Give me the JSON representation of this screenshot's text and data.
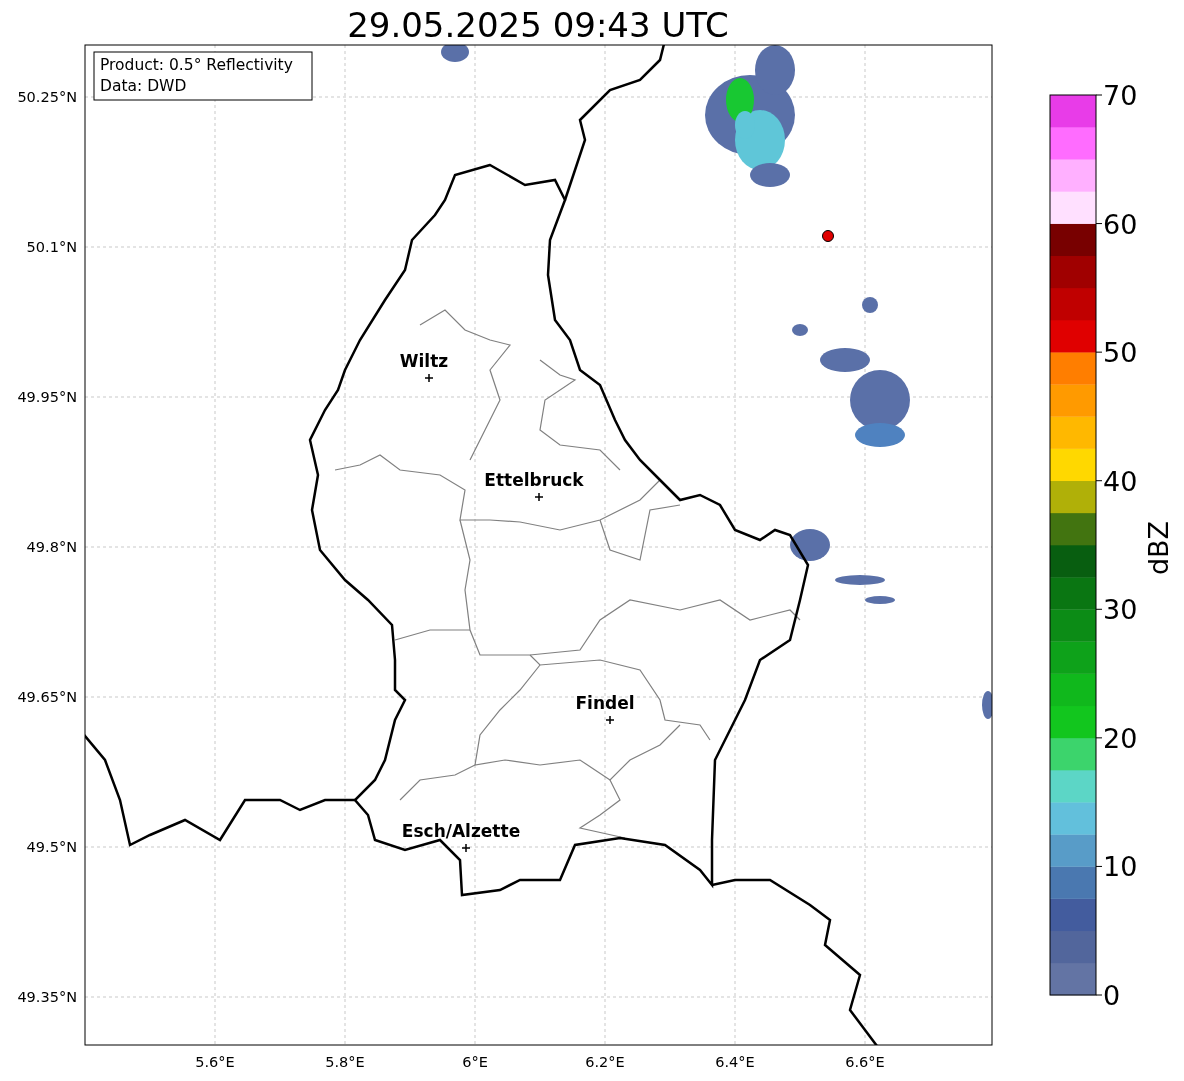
{
  "title": "29.05.2025 09:43 UTC",
  "info_box": {
    "lines": [
      "Product: 0.5° Reflectivity",
      "Data: DWD"
    ]
  },
  "map": {
    "y_tick_labels": [
      "50.25°N",
      "50.1°N",
      "49.95°N",
      "49.8°N",
      "49.65°N",
      "49.5°N",
      "49.35°N"
    ],
    "x_tick_labels": [
      "5.6°E",
      "5.8°E",
      "6°E",
      "6.2°E",
      "6.4°E",
      "6.6°E"
    ],
    "cities": [
      {
        "name": "Wiltz"
      },
      {
        "name": "Ettelbruck"
      },
      {
        "name": "Findel"
      },
      {
        "name": "Esch/Alzette"
      }
    ]
  },
  "colorbar": {
    "label": "dBZ",
    "tick_labels": [
      "70",
      "60",
      "50",
      "40",
      "30",
      "20",
      "10",
      "0"
    ],
    "bins": [
      {
        "color": "#6374a4"
      },
      {
        "color": "#52669c"
      },
      {
        "color": "#435c9e"
      },
      {
        "color": "#4a78b0"
      },
      {
        "color": "#589cc8"
      },
      {
        "color": "#62c0dc"
      },
      {
        "color": "#5cd6c6"
      },
      {
        "color": "#3cd46c"
      },
      {
        "color": "#12c61e"
      },
      {
        "color": "#10b81c"
      },
      {
        "color": "#0ea21a"
      },
      {
        "color": "#0c8c16"
      },
      {
        "color": "#0a7612"
      },
      {
        "color": "#085e10"
      },
      {
        "color": "#427410"
      },
      {
        "color": "#b0b008"
      },
      {
        "color": "#ffd800"
      },
      {
        "color": "#ffb800"
      },
      {
        "color": "#ff9a00"
      },
      {
        "color": "#ff7e00"
      },
      {
        "color": "#e00000"
      },
      {
        "color": "#c00000"
      },
      {
        "color": "#a00000"
      },
      {
        "color": "#780000"
      },
      {
        "color": "#ffe0ff"
      },
      {
        "color": "#ffb0ff"
      },
      {
        "color": "#ff6cff"
      },
      {
        "color": "#e83ce8"
      }
    ]
  }
}
